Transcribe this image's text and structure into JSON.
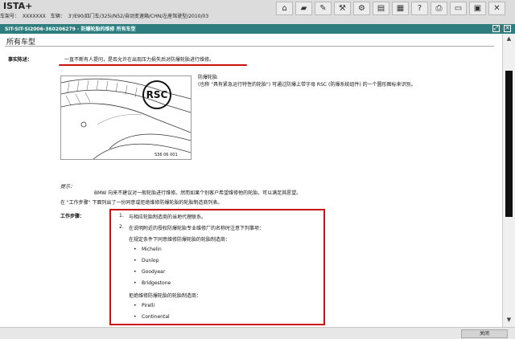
{
  "app": {
    "title": "ISTA+",
    "vehicle_id_label": "车架号：",
    "vehicle_id": "XXXXXXX",
    "vehicle_label": "车辆：",
    "vehicle": "3'/E90/四门车/325i/N52/自动变速箱/CHN/左座驾驶型/2010/03"
  },
  "toolbar": {
    "icons": [
      "home-icon",
      "car-icon",
      "notes-icon",
      "tools-icon",
      "wrench-icon",
      "chart-icon",
      "grid-icon",
      "help-icon",
      "print-icon",
      "minimize-icon",
      "close-icon"
    ]
  },
  "document": {
    "header": "SIT-SIT-SI2006-360206279 - 防爆轮胎的维修 所有车型",
    "section_title": "所有车型",
    "fact_label": "事实陈述：",
    "fact_text": "一直不断有人提问，是否允许在出现压力损失后对防爆轮胎进行维修。",
    "image_label": "RSC",
    "image_code": "S36 06 001",
    "runflat_title": "防爆轮胎",
    "runflat_text": "(也称 \"具有紧急运行特性的轮胎\") 可通过防爆上带字母 RSC (防爆系统组件) 的一个圆形图标来识别。",
    "hint_label": "提示：",
    "hint_text": "BMW 向来不建议对一般轮胎进行维修。然而如果个别客户希望维修他的轮胎，可以满足其愿望。",
    "work_steps_note": "在 \"工作步骤\" 下面列出了一份同意或拒绝维修防爆轮胎的轮胎制造商列表。",
    "work_steps_label": "工作步骤：",
    "step1": "与相应轮胎制造商的当地代理联系。",
    "step2": "在说明附近的授权防爆轮胎专业维修厂的名称时注意下列事项：",
    "approve_title": "在规定条件下同意维修防爆轮胎的轮胎制造商：",
    "approve_list": [
      "Michelin",
      "Dunlop",
      "Goodyear",
      "Bridgestone"
    ],
    "reject_title": "拒绝维修防爆轮胎的轮胎制造商：",
    "reject_list": [
      "Pirelli",
      "Continental"
    ],
    "close_button": "关闭"
  },
  "colors": {
    "header_bg": "#2e7e80",
    "annotation_red": "#cc1111"
  }
}
